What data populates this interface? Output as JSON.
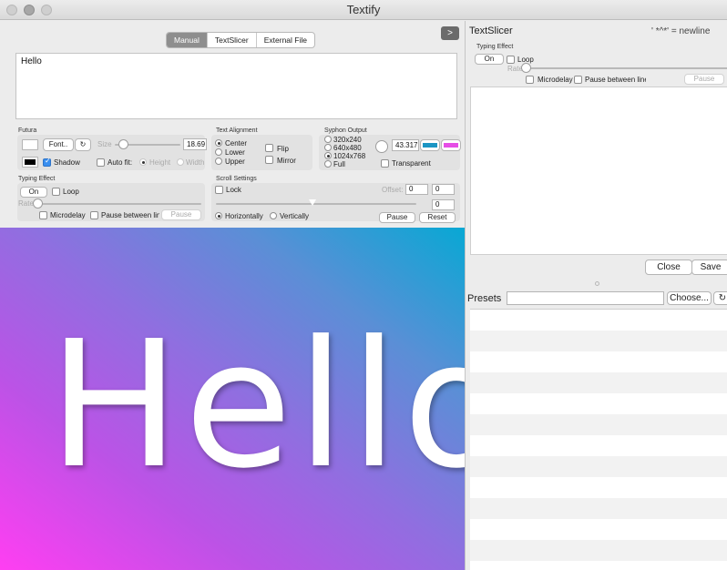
{
  "window": {
    "title": "Textify"
  },
  "tabs": [
    {
      "label": "Manual",
      "selected": true
    },
    {
      "label": "TextSlicer"
    },
    {
      "label": "External File"
    }
  ],
  "arrow_label": ">",
  "text_content": "Hello",
  "font": {
    "group_label": "Futura",
    "font_button": "Font..",
    "refresh_icon": "↻",
    "size_label": "Size",
    "size_value": "18.69",
    "size_fraction": 0.13,
    "shadow_label": "Shadow",
    "shadow_checked": true,
    "autofit_label": "Auto fit:",
    "height_label": "Height",
    "width_label": "Width"
  },
  "alignment": {
    "group_label": "Text Alignment",
    "options": [
      "Center",
      "Lower",
      "Upper"
    ],
    "selected": "Center",
    "flip_label": "Flip",
    "mirror_label": "Mirror"
  },
  "syphon": {
    "group_label": "Syphon Output",
    "options": [
      "320x240",
      "640x480",
      "1024x768",
      "Full"
    ],
    "selected": "1024x768",
    "value": "43.317",
    "transparent_label": "Transparent",
    "swatch1": "#1b95c4",
    "swatch2": "#e64ee6"
  },
  "typing": {
    "group_label": "Typing Effect",
    "on_label": "On",
    "loop_label": "Loop",
    "rate_label": "Rate",
    "rate_fraction": 0.0,
    "microdelay_label": "Microdelay",
    "pause_between_label": "Pause between lines",
    "pause_label": "Pause"
  },
  "scroll": {
    "group_label": "Scroll Settings",
    "lock_label": "Lock",
    "offset_label": "Offset:",
    "offset_x": "0",
    "offset_y": "0",
    "extra_value": "0",
    "horizontal_label": "Horizontally",
    "vertical_label": "Vertically",
    "direction": "Horizontally",
    "pause_label": "Pause",
    "reset_label": "Reset",
    "slider_fraction": 0.48
  },
  "preview": {
    "text": "Hello",
    "color_start": "#ff3ef2",
    "color_end": "#08a8d4"
  },
  "textslicer": {
    "title": "TextSlicer",
    "hint": "' *^*' = newline",
    "typing_label": "Typing Effect",
    "on_label": "On",
    "loop_label": "Loop",
    "rate_label": "Rate",
    "microdelay_label": "Microdelay",
    "pause_between_label": "Pause between lines",
    "pause_label": "Pause",
    "close_label": "Close",
    "save_label": "Save"
  },
  "presets": {
    "label": "Presets",
    "field_value": "",
    "choose_label": "Choose...",
    "refresh_icon": "↻"
  }
}
